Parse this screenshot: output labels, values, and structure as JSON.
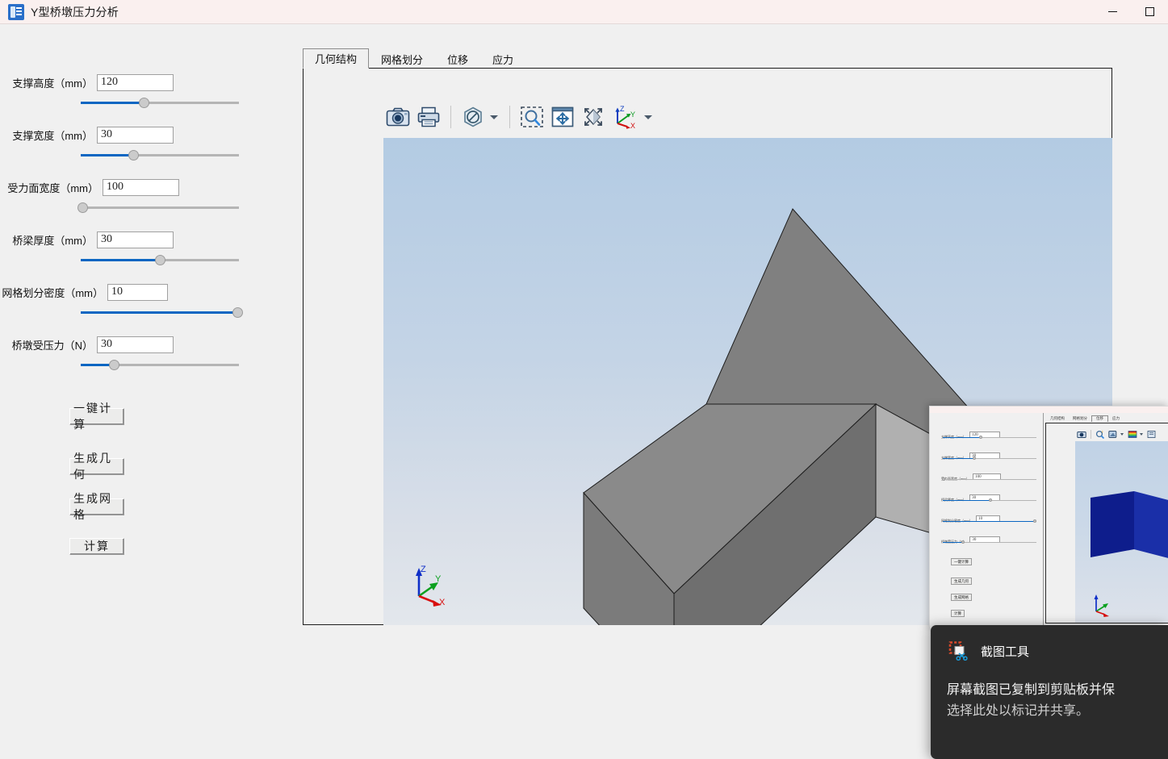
{
  "window": {
    "title": "Y型桥墩压力分析",
    "app_icon": "bridge-analysis-icon",
    "controls": [
      {
        "name": "minimize",
        "glyph": "minimize-icon"
      },
      {
        "name": "maximize",
        "glyph": "maximize-icon"
      }
    ],
    "titlebar_color": "#faf0ef"
  },
  "parameters": [
    {
      "label": "支撑高度（mm）",
      "value": "120",
      "slider_percent": 40
    },
    {
      "label": "支撑宽度（mm）",
      "value": "30",
      "slider_percent": 33
    },
    {
      "label": "受力面宽度（mm）",
      "value": "100",
      "slider_percent": 1
    },
    {
      "label": "桥梁厚度（mm）",
      "value": "30",
      "slider_percent": 50
    },
    {
      "label": "网格划分密度（mm）",
      "value": "10",
      "slider_percent": 97
    },
    {
      "label": "桥墩受压力（N）",
      "value": "30",
      "slider_percent": 21
    }
  ],
  "buttons": [
    {
      "label": "一键计算",
      "name": "one-click-calculate-button"
    },
    {
      "label": "生成几何",
      "name": "generate-geometry-button"
    },
    {
      "label": "生成网格",
      "name": "generate-mesh-button"
    },
    {
      "label": "计算",
      "name": "calculate-button"
    }
  ],
  "tabs": [
    {
      "label": "几何结构",
      "active": true
    },
    {
      "label": "网格划分",
      "active": false
    },
    {
      "label": "位移",
      "active": false
    },
    {
      "label": "应力",
      "active": false
    }
  ],
  "toolbar": [
    {
      "name": "screenshot-camera-icon",
      "type": "button"
    },
    {
      "name": "print-icon",
      "type": "button"
    },
    {
      "name": "no-color-icon",
      "type": "dropdown-button"
    },
    {
      "name": "zoom-select-icon",
      "type": "button"
    },
    {
      "name": "pan-icon",
      "type": "button"
    },
    {
      "name": "fit-to-view-icon",
      "type": "button"
    },
    {
      "name": "axes-orientation-icon",
      "type": "dropdown-button"
    }
  ],
  "viewport": {
    "background_top": "#b3cbe3",
    "background_bottom": "#e3e7ec",
    "model_name": "y-shaped-bridge-pier",
    "axes": [
      {
        "label": "Z",
        "color": "#0000cc"
      },
      {
        "label": "Y",
        "color": "#00a000"
      },
      {
        "label": "X",
        "color": "#e00000"
      }
    ]
  },
  "preview_window": {
    "title_bar_color": "#faf0ef",
    "tabs": [
      {
        "label": "几何结构",
        "active": false
      },
      {
        "label": "网格划分",
        "active": false
      },
      {
        "label": "位移",
        "active": true
      },
      {
        "label": "应力",
        "active": false
      }
    ],
    "parameters": [
      {
        "label": "支撑高度（mm）",
        "value": "120",
        "slider_percent": 40
      },
      {
        "label": "支撑宽度（mm）",
        "value": "30",
        "slider_percent": 33
      },
      {
        "label": "受力面宽度（mm）",
        "value": "100",
        "slider_percent": 1
      },
      {
        "label": "桥梁厚度（mm）",
        "value": "30",
        "slider_percent": 50
      },
      {
        "label": "网格划分密度（mm）",
        "value": "10",
        "slider_percent": 97
      },
      {
        "label": "桥墩受压力（N）",
        "value": "30",
        "slider_percent": 21
      }
    ],
    "buttons": [
      {
        "label": "一键计算"
      },
      {
        "label": "生成几何"
      },
      {
        "label": "生成网格"
      },
      {
        "label": "计算"
      }
    ],
    "toolbar": [
      {
        "name": "screenshot-camera-icon"
      },
      {
        "name": "zoom-icon"
      },
      {
        "name": "surface-representation-icon"
      },
      {
        "name": "color-map-icon"
      },
      {
        "name": "rescale-icon"
      }
    ]
  },
  "toast": {
    "icon": "snipping-tool-icon",
    "app_name": "截图工具",
    "line1": "屏幕截图已复制到剪贴板并保",
    "line2": "选择此处以标记并共享。",
    "background": "#2b2b2b"
  }
}
